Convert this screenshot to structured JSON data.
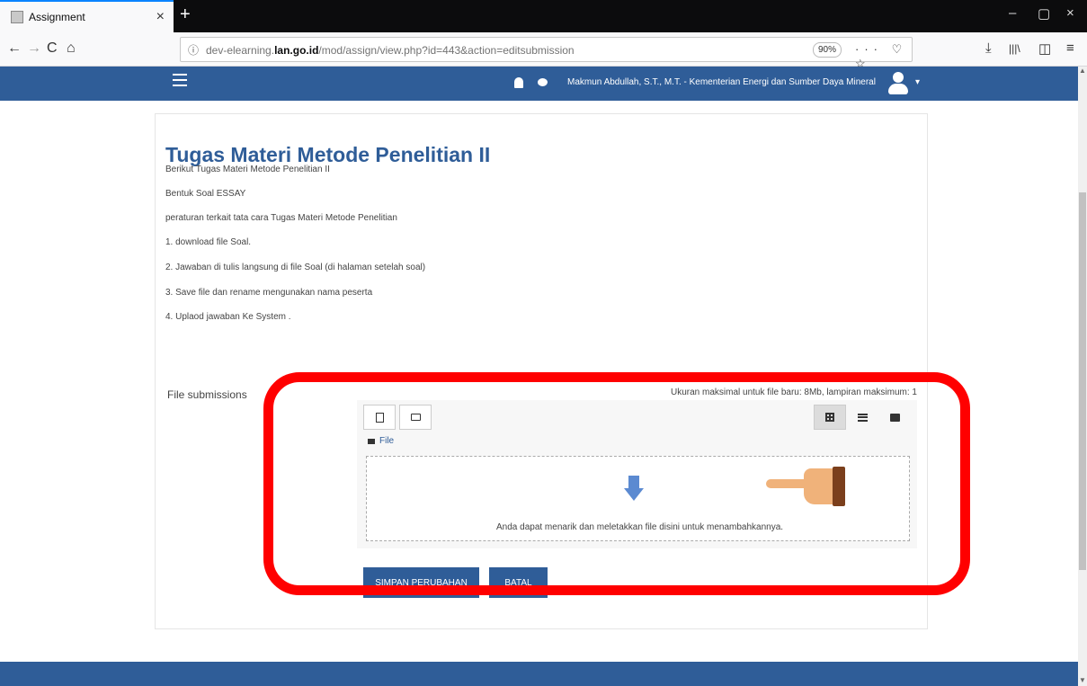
{
  "browser": {
    "tab_title": "Assignment",
    "tab_close": "×",
    "new_tab": "+",
    "url_domain_prefix": "dev-elearning.",
    "url_domain_bold": "lan.go.id",
    "url_path": "/mod/assign/view.php?id=443&action=editsubmission",
    "zoom": "90%",
    "url_actions": "··· ♡ ☆",
    "nav_back": "←",
    "nav_forward": "→",
    "nav_reload": "C",
    "nav_home": "⌂",
    "info_icon": "ⓘ",
    "download_icon": "⤓",
    "library_icon": "|||\\",
    "sidebar_icon": "◫",
    "menu_icon": "≡",
    "win_minimize": "–",
    "win_restore": "▢",
    "win_close": "×"
  },
  "header": {
    "user_name": "Makmun Abdullah, S.T., M.T. - Kementerian Energi dan Sumber Daya Mineral",
    "caret": "▾"
  },
  "main": {
    "title": "Tugas Materi Metode Penelitian II",
    "paragraphs": [
      "Berikut Tugas Materi Metode Penelitian II",
      "Bentuk Soal ESSAY",
      "peraturan terkait tata cara Tugas Materi Metode Penelitian",
      "1. download file Soal.",
      "2. Jawaban di tulis langsung di file Soal (di halaman setelah soal)",
      "3. Save file dan rename mengunakan nama peserta",
      "4. Uplaod jawaban Ke System ."
    ]
  },
  "file_submissions": {
    "label": "File submissions",
    "limit_info": "Ukuran maksimal untuk file baru: 8Mb, lampiran maksimum: 1",
    "path_label": "File",
    "drop_text": "Anda dapat menarik dan meletakkan file disini untuk menambahkannya."
  },
  "buttons": {
    "save": "SIMPAN PERUBAHAN",
    "cancel": "BATAL"
  },
  "colors": {
    "header_blue": "#2f5d98",
    "highlight_red": "#ff0000"
  },
  "icons": [
    "page-icon",
    "bell-icon",
    "chat-icon",
    "user-avatar-icon",
    "new-file-icon",
    "new-folder-icon",
    "grid-view-icon",
    "list-view-icon",
    "tree-view-icon",
    "folder-icon",
    "down-arrow-icon",
    "pointing-hand-icon"
  ]
}
